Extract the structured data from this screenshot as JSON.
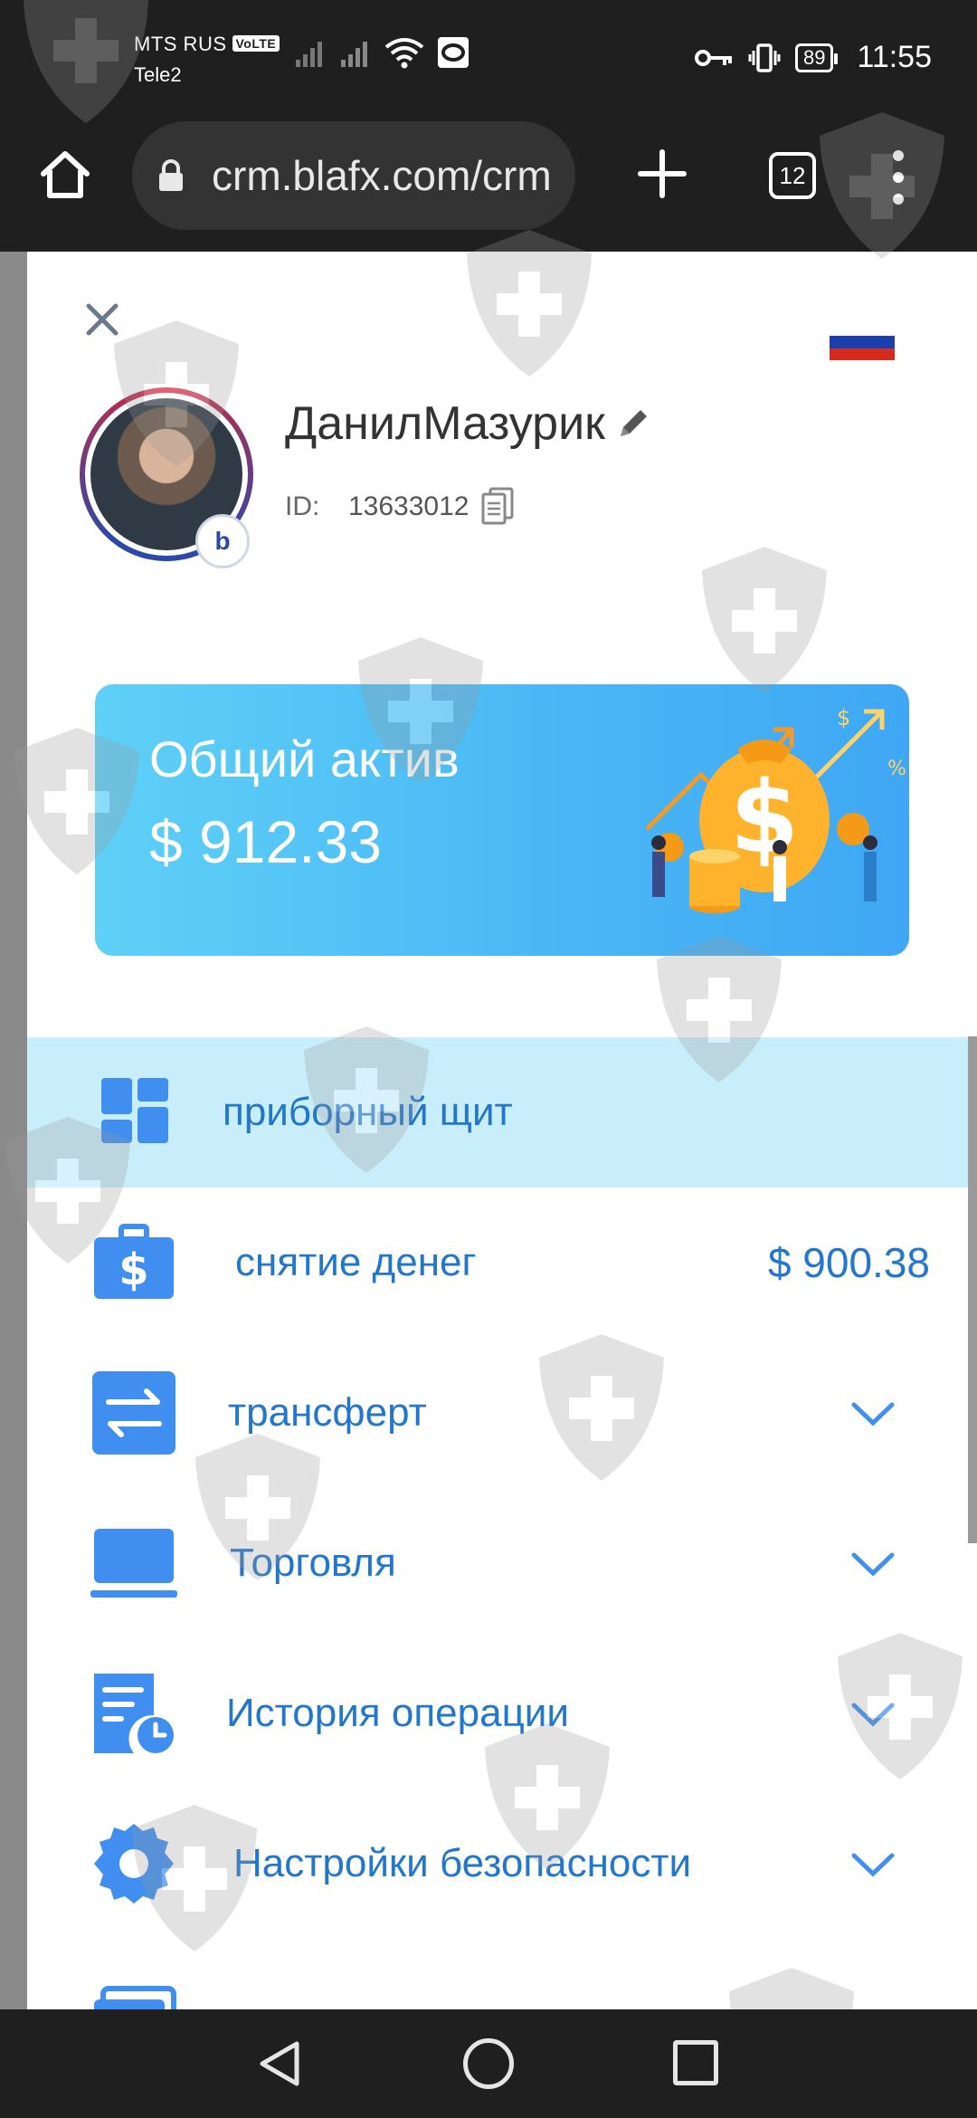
{
  "status_bar": {
    "carrier_primary": "MTS RUS",
    "volte_badge": "VoLTE",
    "carrier_secondary": "Tele2",
    "battery_level": "89",
    "time": "11:55"
  },
  "browser": {
    "url": "crm.blafx.com/crm",
    "tabs_count": "12"
  },
  "drawer": {
    "language_flag": "russia-flag",
    "profile": {
      "name": "ДанилМазурик",
      "id_label": "ID:",
      "id_value": "13633012",
      "badge_text": "b"
    },
    "asset_card": {
      "label": "Общий актив",
      "value": "$ 912.33"
    },
    "menu": [
      {
        "label": "приборный щит",
        "icon": "dashboard-icon",
        "active": true
      },
      {
        "label": "снятие денег",
        "icon": "withdraw-icon",
        "amount": "$ 900.38"
      },
      {
        "label": "трансферт",
        "icon": "transfer-icon",
        "has_chevron": true
      },
      {
        "label": "Торговля",
        "icon": "laptop-icon",
        "has_chevron": true
      },
      {
        "label": "История операции",
        "icon": "history-icon",
        "has_chevron": true
      },
      {
        "label": "Настройки безопасности",
        "icon": "gear-icon",
        "has_chevron": true
      }
    ]
  },
  "colors": {
    "accent_text": "#2277cc",
    "active_item_bg": "#c8eefb",
    "card_gradient_start": "#5fd0f7",
    "card_gradient_end": "#3fa7f4"
  }
}
